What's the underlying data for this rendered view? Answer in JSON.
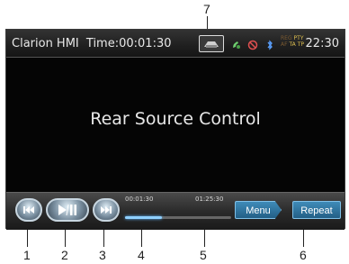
{
  "status_bar": {
    "title": "Clarion HMI",
    "time_label": "Time:00:01:30",
    "source_icon": "source-icon",
    "icons": [
      "phone-icon",
      "mute-icon",
      "bluetooth-icon"
    ],
    "flags": {
      "reg": "REG",
      "pty": "PTY",
      "af": "AF",
      "ta": "TA",
      "tp": "TP"
    },
    "clock": "22:30"
  },
  "main": {
    "label": "Rear Source Control"
  },
  "controls": {
    "elapsed": "00:01:30",
    "total": "01:25:30",
    "progress": 0.35,
    "menu_label": "Menu",
    "repeat_label": "Repeat"
  },
  "callouts": [
    "1",
    "2",
    "3",
    "4",
    "5",
    "6",
    "7"
  ],
  "colors": {
    "accent": "#3f8bb8",
    "progress": "#8fd0ff",
    "flag": "#c2a040"
  }
}
